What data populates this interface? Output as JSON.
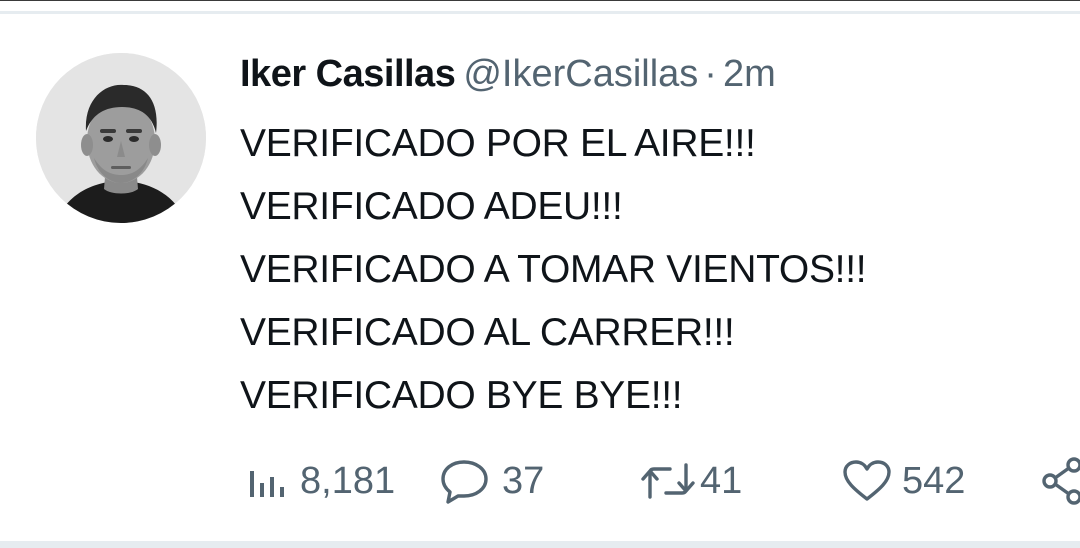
{
  "tweet": {
    "display_name": "Iker Casillas",
    "handle": "@IkerCasillas",
    "separator": "·",
    "time": "2m",
    "lines": [
      "VERIFICADO POR EL AIRE!!!",
      "VERIFICADO ADEU!!!",
      "VERIFICADO A TOMAR VIENTOS!!!",
      "VERIFICADO AL CARRER!!!",
      "VERIFICADO BYE BYE!!!"
    ]
  },
  "actions": {
    "views": {
      "icon": "bar-chart-icon",
      "count": "8,181"
    },
    "replies": {
      "icon": "speech-bubble-icon",
      "count": "37"
    },
    "retweets": {
      "icon": "retweet-icon",
      "count": "41"
    },
    "likes": {
      "icon": "heart-icon",
      "count": "542"
    },
    "share": {
      "icon": "share-icon"
    }
  },
  "colors": {
    "text_primary": "#0f1419",
    "text_secondary": "#536471",
    "divider": "#e6ecf0"
  }
}
